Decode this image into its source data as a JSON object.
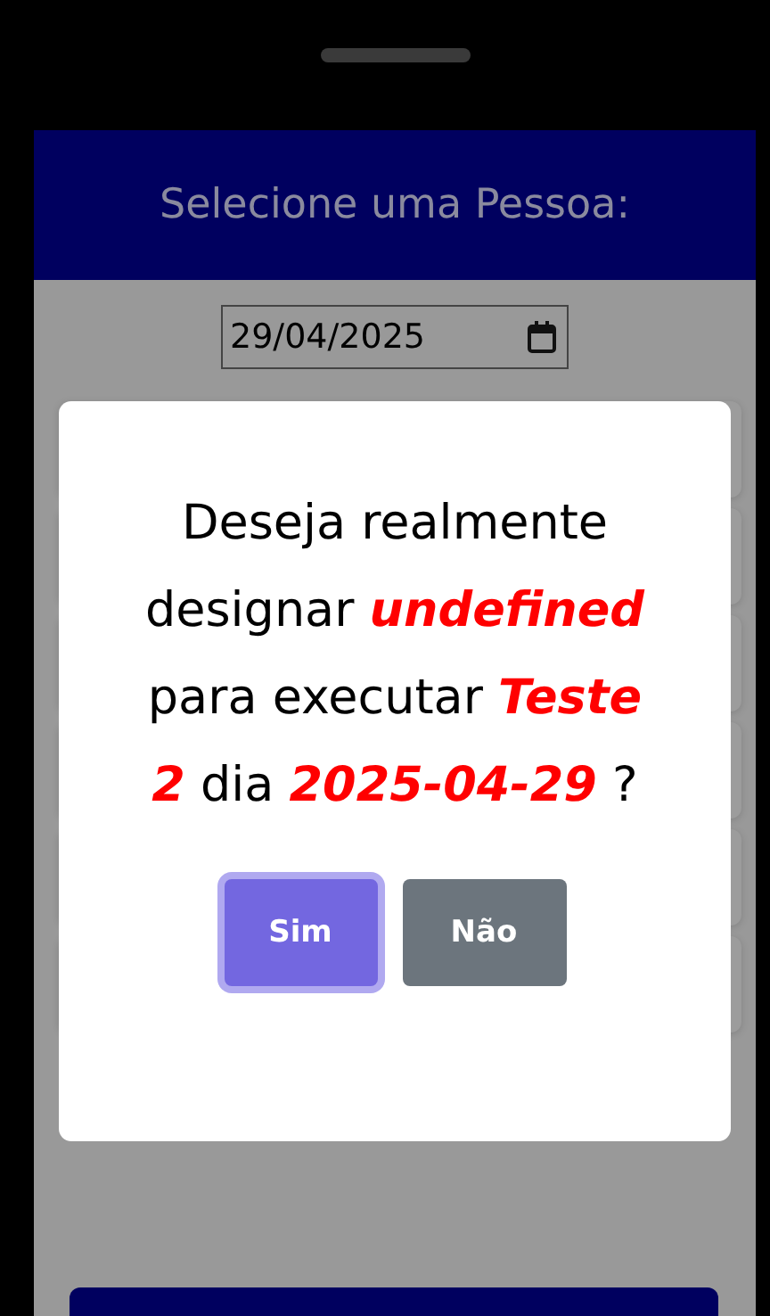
{
  "header": {
    "title": "Selecione uma Pessoa:"
  },
  "date_field": {
    "value": "29/04/2025"
  },
  "dialog": {
    "message_parts": [
      {
        "kind": "plain",
        "text": "Deseja realmente designar "
      },
      {
        "kind": "highlight",
        "text": "undefined"
      },
      {
        "kind": "plain",
        "text": " para executar "
      },
      {
        "kind": "highlight",
        "text": "Teste 2"
      },
      {
        "kind": "plain",
        "text": " dia "
      },
      {
        "kind": "highlight",
        "text": "2025-04-29"
      },
      {
        "kind": "plain",
        "text": " ?"
      }
    ],
    "buttons": [
      {
        "label": "Sim",
        "kind": "confirm",
        "focused": true
      },
      {
        "label": "Não",
        "kind": "cancel",
        "focused": false
      }
    ]
  }
}
